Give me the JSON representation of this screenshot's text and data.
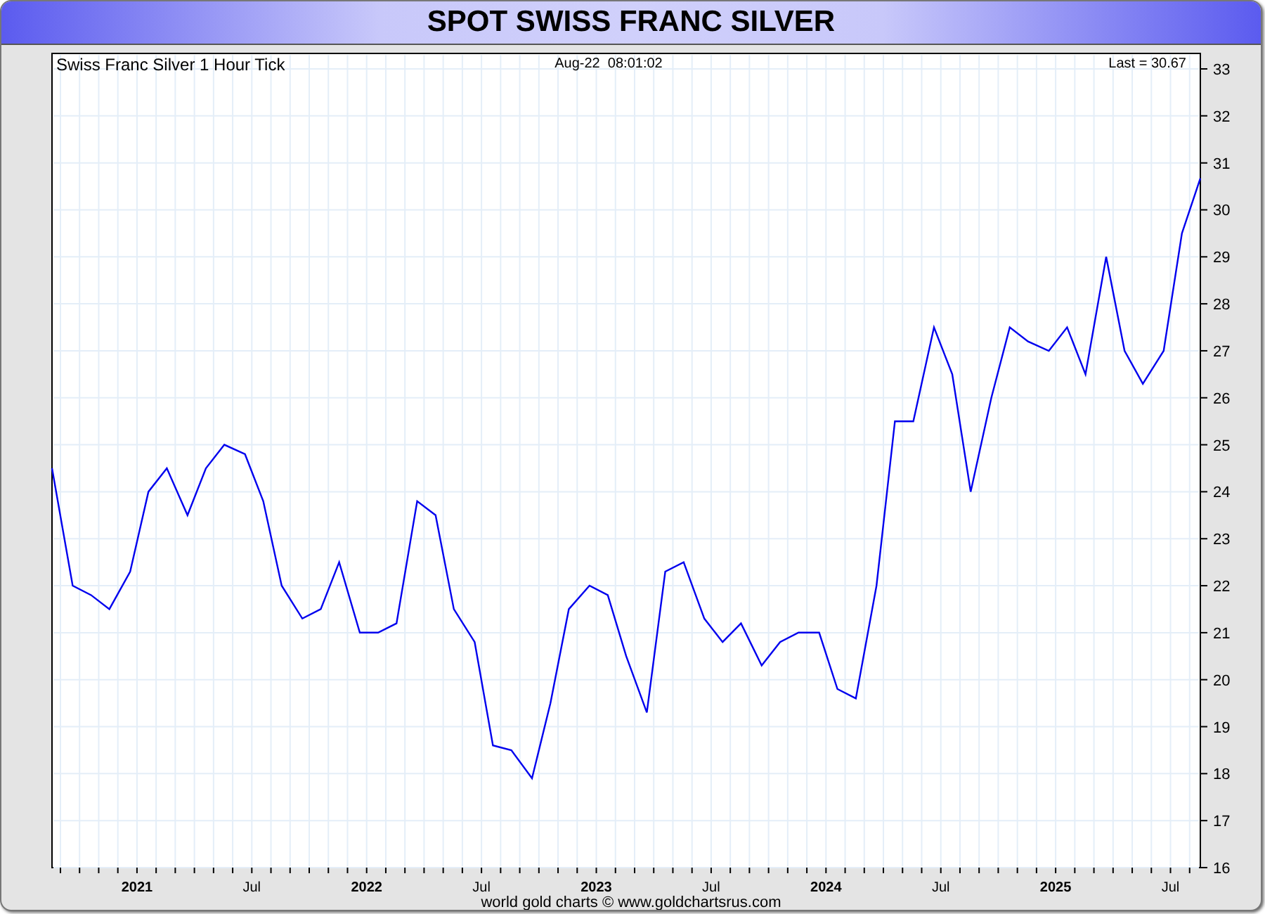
{
  "title": "SPOT SWISS FRANC SILVER",
  "chart": {
    "timestamp": "Aug-22  08:01:02",
    "last": "Last = 30.67",
    "chart_data": {
      "type": "line",
      "title": "Swiss Franc Silver 1 Hour Tick",
      "xlim": [
        2020.63,
        2025.63
      ],
      "grid": true,
      "ylim": [
        16,
        33
      ],
      "yticks": [
        16,
        17,
        18,
        19,
        20,
        21,
        22,
        23,
        24,
        25,
        26,
        27,
        28,
        29,
        30,
        31,
        32,
        33
      ],
      "xticks": [
        {
          "value": 2021,
          "label": "2021"
        },
        {
          "value": 2021.5,
          "label": "Jul"
        },
        {
          "value": 2022,
          "label": "2022"
        },
        {
          "value": 2022.5,
          "label": "Jul"
        },
        {
          "value": 2023,
          "label": "2023"
        },
        {
          "value": 2023.5,
          "label": "Jul"
        },
        {
          "value": 2024,
          "label": "2024"
        },
        {
          "value": 2024.5,
          "label": "Jul"
        },
        {
          "value": 2025,
          "label": "2025"
        },
        {
          "value": 2025.5,
          "label": "Jul"
        }
      ],
      "x": [
        2020.63,
        2020.72,
        2020.8,
        2020.88,
        2020.97,
        2021.05,
        2021.13,
        2021.22,
        2021.3,
        2021.38,
        2021.47,
        2021.55,
        2021.63,
        2021.72,
        2021.8,
        2021.88,
        2021.97,
        2022.05,
        2022.13,
        2022.22,
        2022.3,
        2022.38,
        2022.47,
        2022.55,
        2022.63,
        2022.72,
        2022.8,
        2022.88,
        2022.97,
        2023.05,
        2023.13,
        2023.22,
        2023.3,
        2023.38,
        2023.47,
        2023.55,
        2023.63,
        2023.72,
        2023.8,
        2023.88,
        2023.97,
        2024.05,
        2024.13,
        2024.22,
        2024.3,
        2024.38,
        2024.47,
        2024.55,
        2024.63,
        2024.72,
        2024.8,
        2024.88,
        2024.97,
        2025.05,
        2025.13,
        2025.22,
        2025.3,
        2025.38,
        2025.47,
        2025.55,
        2025.63
      ],
      "series": [
        {
          "color": "#0000ee",
          "values": [
            24.5,
            22,
            21.8,
            21.5,
            22.3,
            24,
            24.5,
            23.5,
            24.5,
            25,
            24.8,
            23.8,
            22,
            21.3,
            21.5,
            22.5,
            21,
            21,
            21.2,
            23.8,
            23.5,
            21.5,
            20.8,
            18.6,
            18.5,
            17.9,
            19.5,
            21.5,
            22,
            21.8,
            20.5,
            19.3,
            22.3,
            22.5,
            21.3,
            20.8,
            21.2,
            20.3,
            20.8,
            21,
            21,
            19.8,
            19.6,
            22,
            25.5,
            25.5,
            27.5,
            26.5,
            24,
            26,
            27.5,
            27.2,
            27,
            27.5,
            26.5,
            29,
            27,
            26.3,
            27,
            29.5,
            30.67
          ]
        }
      ]
    }
  },
  "footer": "world gold charts © www.goldchartsrus.com"
}
